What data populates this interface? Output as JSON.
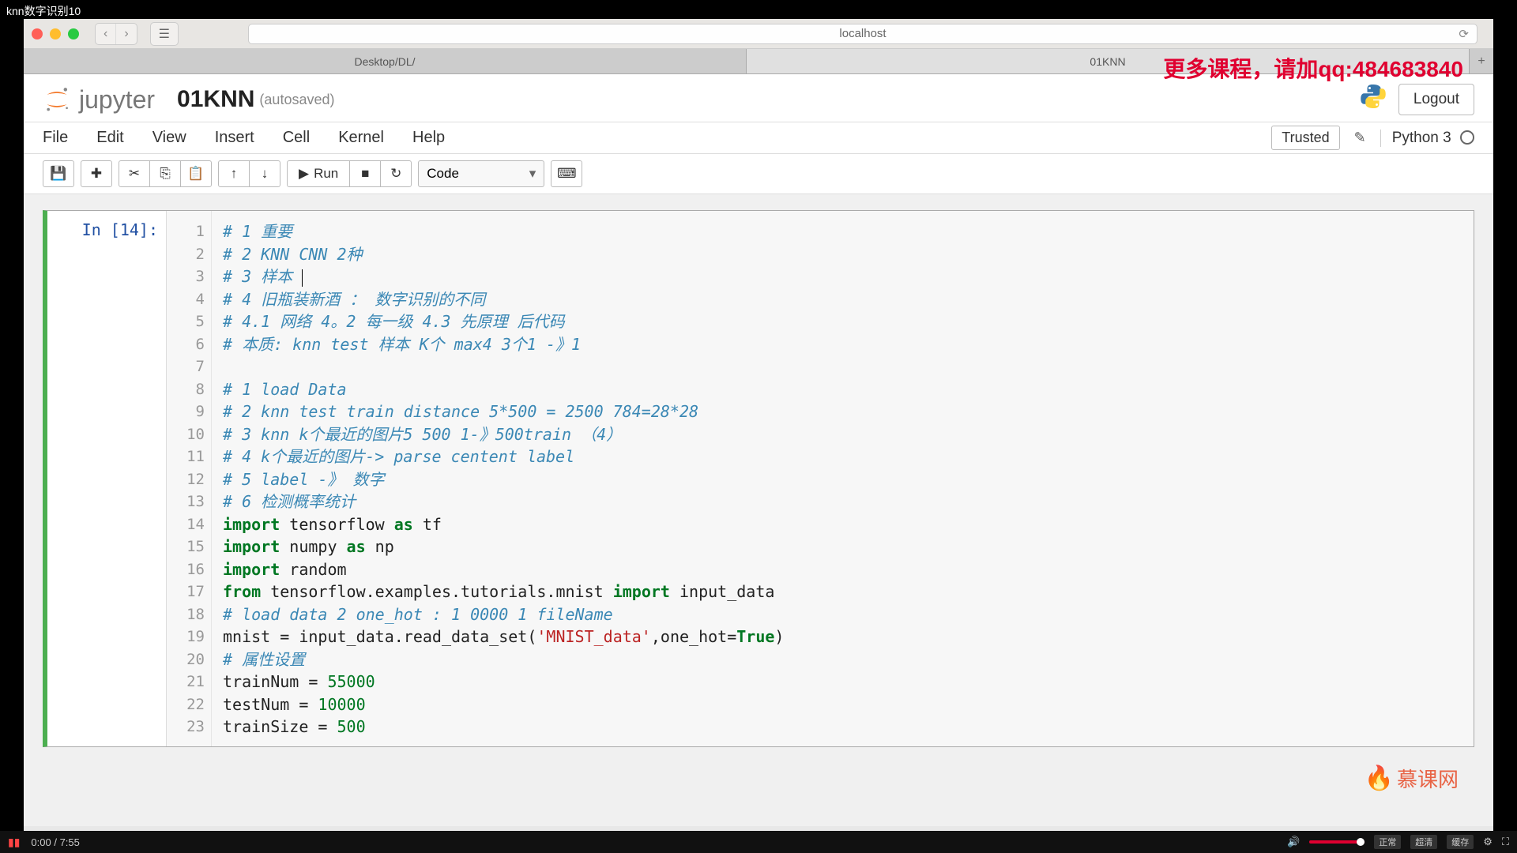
{
  "window_title": "knn数字识别10",
  "browser": {
    "url": "localhost",
    "tabs": [
      "Desktop/DL/",
      "01KNN"
    ],
    "active_tab": 1
  },
  "overlay_ad": "更多课程，请加qq:484683840",
  "jupyter": {
    "logo_text": "jupyter",
    "notebook_name": "01KNN",
    "autosave_label": "(autosaved)",
    "logout_label": "Logout",
    "kernel": "Python 3",
    "trusted_label": "Trusted",
    "menus": [
      "File",
      "Edit",
      "View",
      "Insert",
      "Cell",
      "Kernel",
      "Help"
    ],
    "run_label": "Run",
    "celltype": "Code",
    "cell_prompt": "In [14]:",
    "code_lines": [
      {
        "n": 1,
        "html": "<span class=\"cm-comment\"># 1 重要</span>"
      },
      {
        "n": 2,
        "html": "<span class=\"cm-comment\"># 2 KNN CNN 2种</span>"
      },
      {
        "n": 3,
        "html": "<span class=\"cm-comment\"># 3 样本 </span><span class=\"cursor-caret\"></span>"
      },
      {
        "n": 4,
        "html": "<span class=\"cm-comment\"># 4 旧瓶装新酒 ： 数字识别的不同</span>"
      },
      {
        "n": 5,
        "html": "<span class=\"cm-comment\"># 4.1 网络 4。2 每一级 4.3 先原理 后代码</span>"
      },
      {
        "n": 6,
        "html": "<span class=\"cm-comment\"># 本质: knn test 样本 K个 max4 3个1 -》1</span>"
      },
      {
        "n": 7,
        "html": ""
      },
      {
        "n": 8,
        "html": "<span class=\"cm-comment\"># 1 load Data</span>"
      },
      {
        "n": 9,
        "html": "<span class=\"cm-comment\"># 2 knn test train distance 5*500 = 2500 784=28*28</span>"
      },
      {
        "n": 10,
        "html": "<span class=\"cm-comment\"># 3 knn k个最近的图片5 500 1-》500train （4）</span>"
      },
      {
        "n": 11,
        "html": "<span class=\"cm-comment\"># 4 k个最近的图片-> parse centent label</span>"
      },
      {
        "n": 12,
        "html": "<span class=\"cm-comment\"># 5 label -》 数字</span>"
      },
      {
        "n": 13,
        "html": "<span class=\"cm-comment\"># 6 检测概率统计</span>"
      },
      {
        "n": 14,
        "html": "<span class=\"cm-keyword\">import</span> tensorflow <span class=\"cm-keyword\">as</span> tf"
      },
      {
        "n": 15,
        "html": "<span class=\"cm-keyword\">import</span> numpy <span class=\"cm-keyword\">as</span> np"
      },
      {
        "n": 16,
        "html": "<span class=\"cm-keyword\">import</span> random"
      },
      {
        "n": 17,
        "html": "<span class=\"cm-keyword\">from</span> tensorflow.examples.tutorials.mnist <span class=\"cm-keyword\">import</span> input_data"
      },
      {
        "n": 18,
        "html": "<span class=\"cm-comment\"># load data 2 one_hot : 1 0000 1 fileName</span>"
      },
      {
        "n": 19,
        "html": "mnist = input_data.read_data_set(<span class=\"cm-string\">'MNIST_data'</span>,one_hot=<span class=\"cm-bool\">True</span>)"
      },
      {
        "n": 20,
        "html": "<span class=\"cm-comment\"># 属性设置</span>"
      },
      {
        "n": 21,
        "html": "trainNum = <span class=\"cm-number\">55000</span>"
      },
      {
        "n": 22,
        "html": "testNum = <span class=\"cm-number\">10000</span>"
      },
      {
        "n": 23,
        "html": "trainSize = <span class=\"cm-number\">500</span>"
      }
    ]
  },
  "video": {
    "time_current": "0:00",
    "time_total": "7:55",
    "badges": [
      "正常",
      "超清",
      "缓存"
    ]
  },
  "watermark": "慕课网"
}
